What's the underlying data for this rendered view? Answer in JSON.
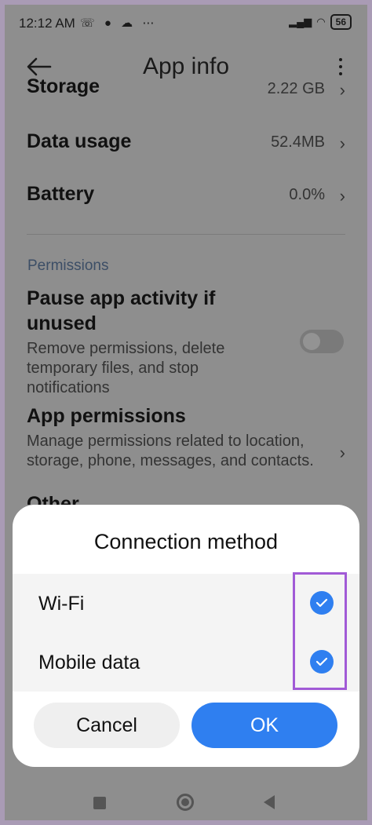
{
  "status_bar": {
    "time": "12:12 AM",
    "battery": "56"
  },
  "toolbar": {
    "title": "App info"
  },
  "rows": {
    "storage_label": "Storage",
    "storage_value": "2.22 GB",
    "data_usage_label": "Data usage",
    "data_usage_value": "52.4MB",
    "battery_label": "Battery",
    "battery_value": "0.0%"
  },
  "permissions": {
    "section_title": "Permissions",
    "pause_title": "Pause app activity if unused",
    "pause_desc": "Remove permissions, delete temporary files, and stop notifications",
    "pause_enabled": false,
    "app_permissions_title": "App permissions",
    "app_permissions_desc": "Manage permissions related to location, storage, phone, messages, and contacts.",
    "other_title": "Other"
  },
  "dialog": {
    "title": "Connection method",
    "options": [
      {
        "label": "Wi-Fi",
        "checked": true
      },
      {
        "label": "Mobile data",
        "checked": true
      }
    ],
    "cancel_label": "Cancel",
    "ok_label": "OK"
  },
  "colors": {
    "accent": "#2f7ff0",
    "highlight": "#a15ad6"
  }
}
